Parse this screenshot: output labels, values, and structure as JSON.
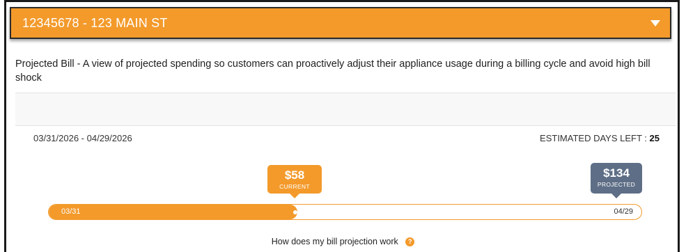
{
  "account": {
    "title": "12345678 - 123 MAIN ST",
    "accent_color": "#f39a2b"
  },
  "description": "Projected Bill - A view of projected spending so customers can proactively adjust their appliance usage during a billing cycle and avoid high bill shock",
  "billing_cycle": {
    "date_range": "03/31/2026 - 04/29/2026",
    "days_left_label": "ESTIMATED DAYS LEFT :",
    "days_left_value": "25",
    "start_label": "03/31",
    "end_label": "04/29",
    "progress_fraction": 0.42
  },
  "current": {
    "amount": "$58",
    "label": "CURRENT",
    "color": "#f39a2b"
  },
  "projected": {
    "amount": "$134",
    "label": "PROJECTED",
    "color": "#5e6e86"
  },
  "help": {
    "text": "How does my bill projection work",
    "icon": "question-icon",
    "glyph": "?"
  }
}
